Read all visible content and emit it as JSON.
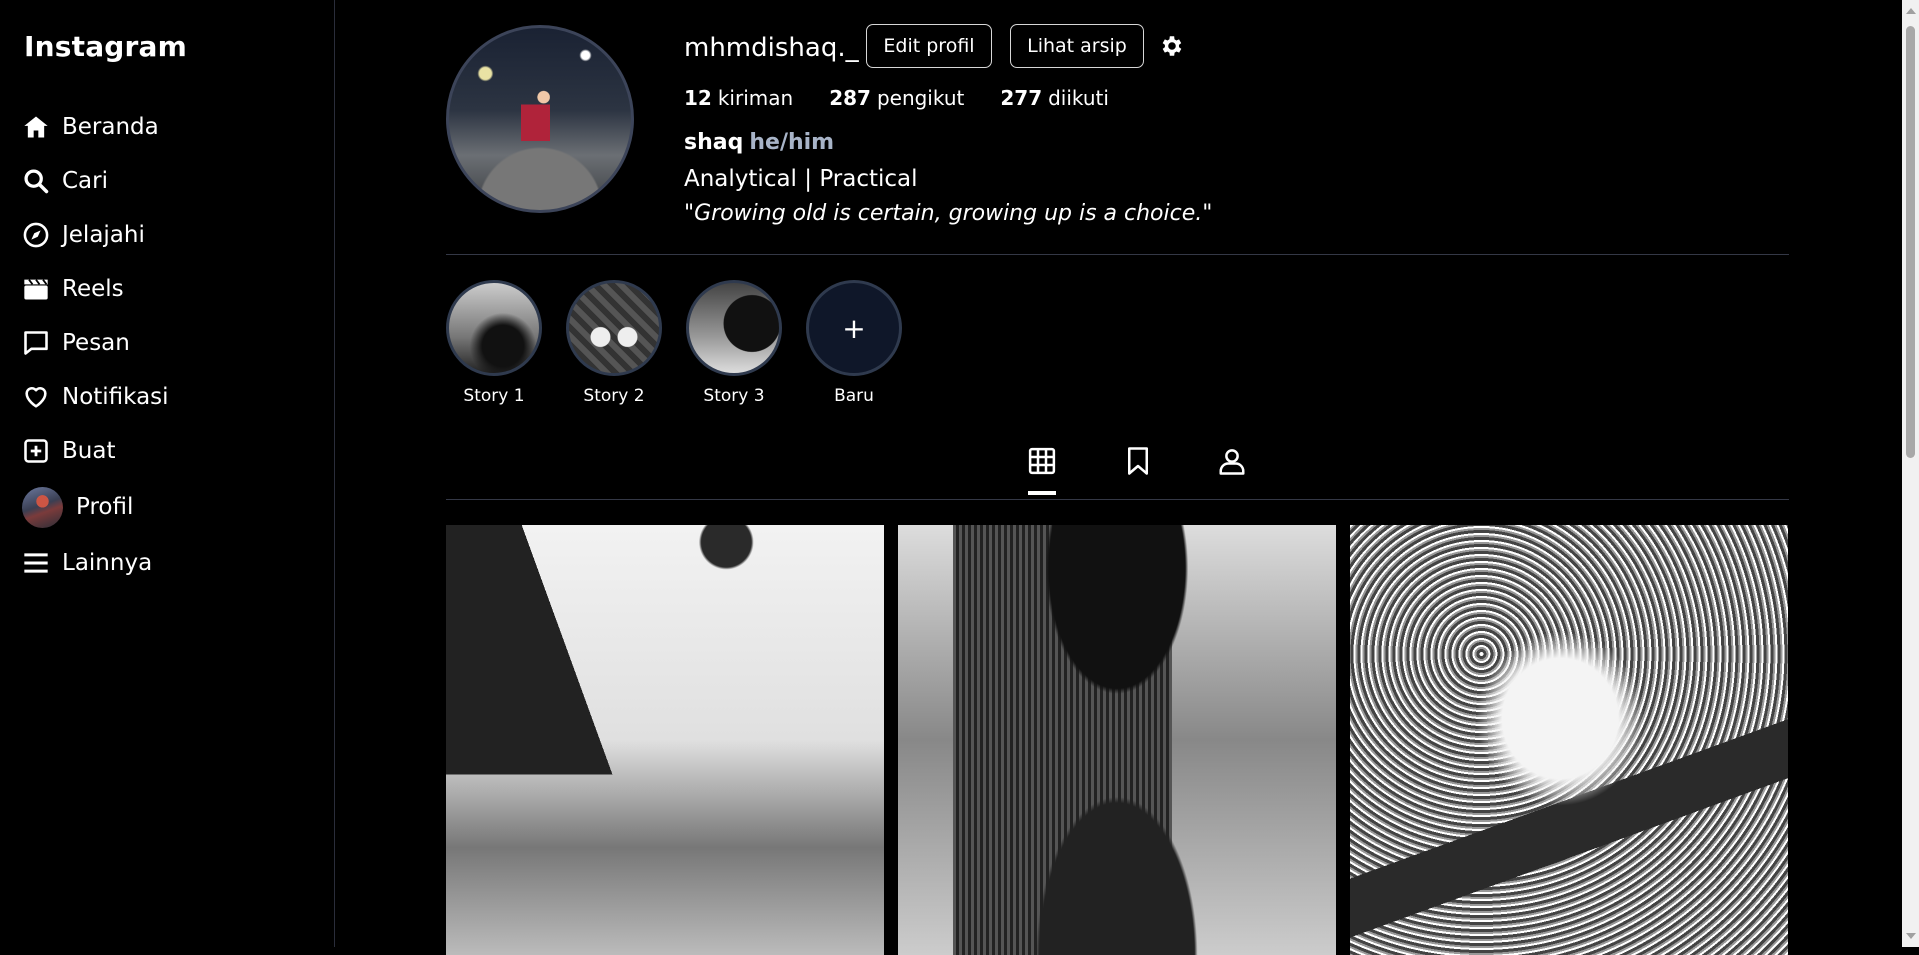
{
  "sidebar": {
    "logo": "Instagram",
    "items": [
      {
        "label": "Beranda",
        "icon": "home-icon"
      },
      {
        "label": "Cari",
        "icon": "search-icon"
      },
      {
        "label": "Jelajahi",
        "icon": "compass-icon"
      },
      {
        "label": "Reels",
        "icon": "clapperboard-icon"
      },
      {
        "label": "Pesan",
        "icon": "message-icon"
      },
      {
        "label": "Notifikasi",
        "icon": "heart-icon"
      },
      {
        "label": "Buat",
        "icon": "plus-square-icon"
      },
      {
        "label": "Profil",
        "icon": "avatar"
      },
      {
        "label": "Lainnya",
        "icon": "menu-icon"
      }
    ]
  },
  "profile": {
    "username": "mhmdishaq._",
    "edit_label": "Edit profil",
    "archive_label": "Lihat arsip",
    "stats": {
      "posts_count": "12",
      "posts_label": "kiriman",
      "followers_count": "287",
      "followers_label": "pengikut",
      "following_count": "277",
      "following_label": "diikuti"
    },
    "name": "shaq",
    "pronouns": "he/him",
    "bio_line": "Analytical | Practical",
    "bio_quote": "\"Growing old is certain, growing up is a choice.\""
  },
  "stories": [
    {
      "label": "Story 1"
    },
    {
      "label": "Story 2"
    },
    {
      "label": "Story 3"
    },
    {
      "label": "Baru",
      "symbol": "+"
    }
  ],
  "tabs": [
    "grid-icon",
    "bookmark-icon",
    "user-tag-icon"
  ],
  "colors": {
    "background": "#000000",
    "text": "#ffffff",
    "pronoun": "#a8b4c8",
    "border": "#343846"
  }
}
